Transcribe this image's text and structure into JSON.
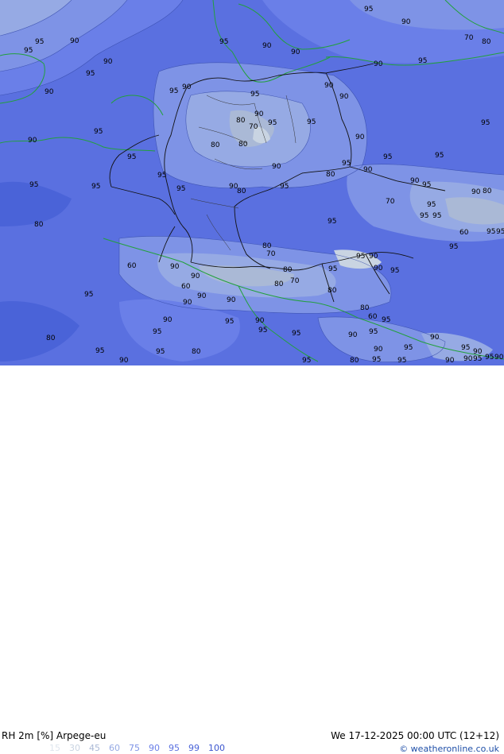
{
  "title": {
    "left": "RH 2m [%] Arpege-eu",
    "right": "We 17-12-2025 00:00 UTC (12+12)"
  },
  "legend": [
    {
      "label": "15",
      "color": "#dfe6ee"
    },
    {
      "label": "30",
      "color": "#c9d4e2"
    },
    {
      "label": "45",
      "color": "#aab9d6"
    },
    {
      "label": "60",
      "color": "#96aae4"
    },
    {
      "label": "75",
      "color": "#7e93e6"
    },
    {
      "label": "90",
      "color": "#6a7fe8"
    },
    {
      "label": "95",
      "color": "#5a70e0"
    },
    {
      "label": "99",
      "color": "#4a63d8"
    },
    {
      "label": "100",
      "color": "#3b56cf"
    }
  ],
  "credit": "© weatheronline.co.uk",
  "contour_labels": [
    {
      "text": "95"
    },
    {
      "text": "90"
    },
    {
      "text": "95"
    },
    {
      "text": "90"
    },
    {
      "text": "95"
    },
    {
      "text": "70"
    },
    {
      "text": "80"
    },
    {
      "text": "95"
    },
    {
      "text": "90"
    },
    {
      "text": "90"
    },
    {
      "text": "95"
    },
    {
      "text": "90"
    },
    {
      "text": "90"
    },
    {
      "text": "95"
    },
    {
      "text": "90"
    },
    {
      "text": "95"
    },
    {
      "text": "90"
    },
    {
      "text": "90"
    },
    {
      "text": "95"
    },
    {
      "text": "90"
    },
    {
      "text": "80"
    },
    {
      "text": "70"
    },
    {
      "text": "95"
    },
    {
      "text": "90"
    },
    {
      "text": "95"
    },
    {
      "text": "95"
    },
    {
      "text": "95"
    },
    {
      "text": "90"
    },
    {
      "text": "80"
    },
    {
      "text": "80"
    },
    {
      "text": "90"
    },
    {
      "text": "95"
    },
    {
      "text": "95"
    },
    {
      "text": "90"
    },
    {
      "text": "90"
    },
    {
      "text": "80"
    },
    {
      "text": "95"
    },
    {
      "text": "95"
    },
    {
      "text": "95"
    },
    {
      "text": "95"
    },
    {
      "text": "95"
    },
    {
      "text": "90"
    },
    {
      "text": "95"
    },
    {
      "text": "80"
    },
    {
      "text": "95"
    },
    {
      "text": "90"
    },
    {
      "text": "95"
    },
    {
      "text": "90"
    },
    {
      "text": "80"
    },
    {
      "text": "70"
    },
    {
      "text": "95"
    },
    {
      "text": "95"
    },
    {
      "text": "95"
    },
    {
      "text": "80"
    },
    {
      "text": "60"
    },
    {
      "text": "95"
    },
    {
      "text": "95"
    },
    {
      "text": "95"
    },
    {
      "text": "95"
    },
    {
      "text": "60"
    },
    {
      "text": "80"
    },
    {
      "text": "70"
    },
    {
      "text": "95"
    },
    {
      "text": "90"
    },
    {
      "text": "95"
    },
    {
      "text": "90"
    },
    {
      "text": "95"
    },
    {
      "text": "90"
    },
    {
      "text": "90"
    },
    {
      "text": "80"
    },
    {
      "text": "70"
    },
    {
      "text": "80"
    },
    {
      "text": "60"
    },
    {
      "text": "90"
    },
    {
      "text": "90"
    },
    {
      "text": "80"
    },
    {
      "text": "95"
    },
    {
      "text": "90"
    },
    {
      "text": "80"
    },
    {
      "text": "60"
    },
    {
      "text": "95"
    },
    {
      "text": "90"
    },
    {
      "text": "95"
    },
    {
      "text": "95"
    },
    {
      "text": "90"
    },
    {
      "text": "95"
    },
    {
      "text": "95"
    },
    {
      "text": "90"
    },
    {
      "text": "95"
    },
    {
      "text": "80"
    },
    {
      "text": "95"
    },
    {
      "text": "95"
    },
    {
      "text": "80"
    },
    {
      "text": "90"
    },
    {
      "text": "95"
    },
    {
      "text": "90"
    },
    {
      "text": "95"
    },
    {
      "text": "90"
    },
    {
      "text": "90"
    },
    {
      "text": "95"
    },
    {
      "text": "95"
    },
    {
      "text": "90"
    },
    {
      "text": "95"
    },
    {
      "text": "80"
    },
    {
      "text": "95"
    },
    {
      "text": "90"
    },
    {
      "text": "95"
    },
    {
      "text": "90"
    }
  ]
}
